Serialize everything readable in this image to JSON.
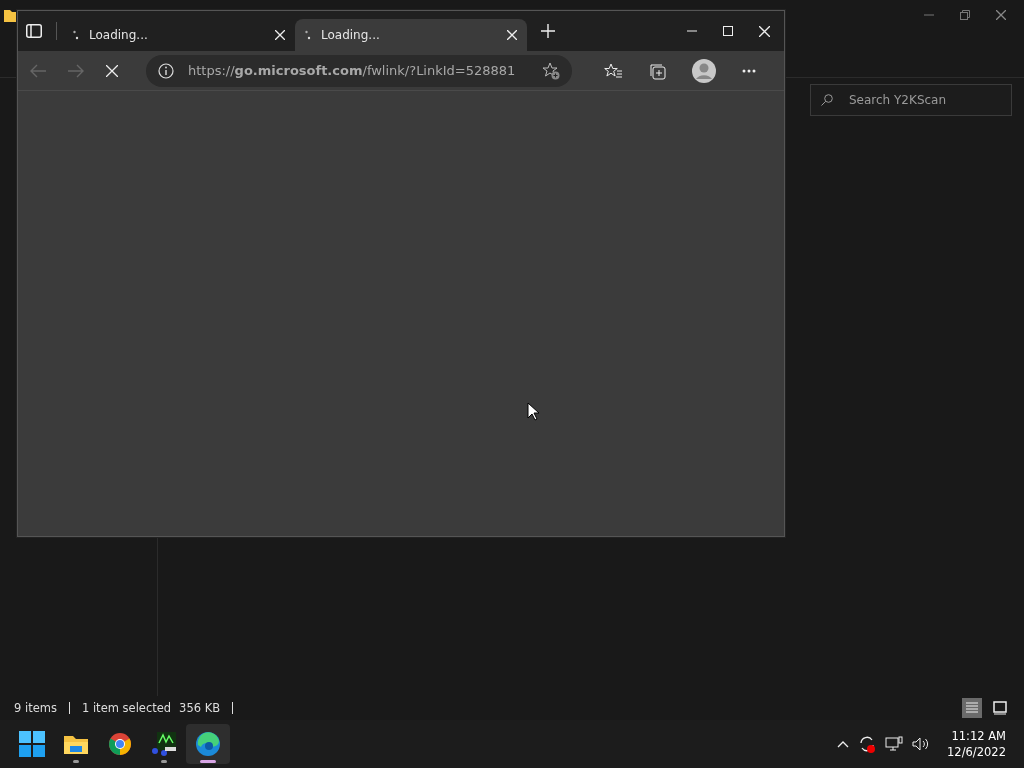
{
  "explorer": {
    "search": {
      "placeholder": "Search Y2KScan"
    },
    "status_bar": {
      "item_count": "9 items",
      "selection": "1 item selected",
      "size": "356 KB"
    },
    "view_modes": [
      {
        "kind": "details",
        "selected": true
      },
      {
        "kind": "tiles",
        "selected": false
      }
    ]
  },
  "browser": {
    "tabs": [
      {
        "title": "Loading...",
        "selected": false
      },
      {
        "title": "Loading...",
        "selected": true
      }
    ],
    "address": "https://**go.microsoft.com**/fwlink/?LinkId=528881"
  },
  "taskbar": {
    "apps": [
      {
        "kind": "start",
        "running": false,
        "active": false
      },
      {
        "kind": "files",
        "running": true,
        "active": false
      },
      {
        "kind": "chrome",
        "running": false,
        "active": false
      },
      {
        "kind": "y2k",
        "running": true,
        "active": false
      },
      {
        "kind": "edge",
        "running": true,
        "active": true
      }
    ],
    "clock": {
      "time": "11:12 AM",
      "date": "12/6/2022"
    }
  }
}
